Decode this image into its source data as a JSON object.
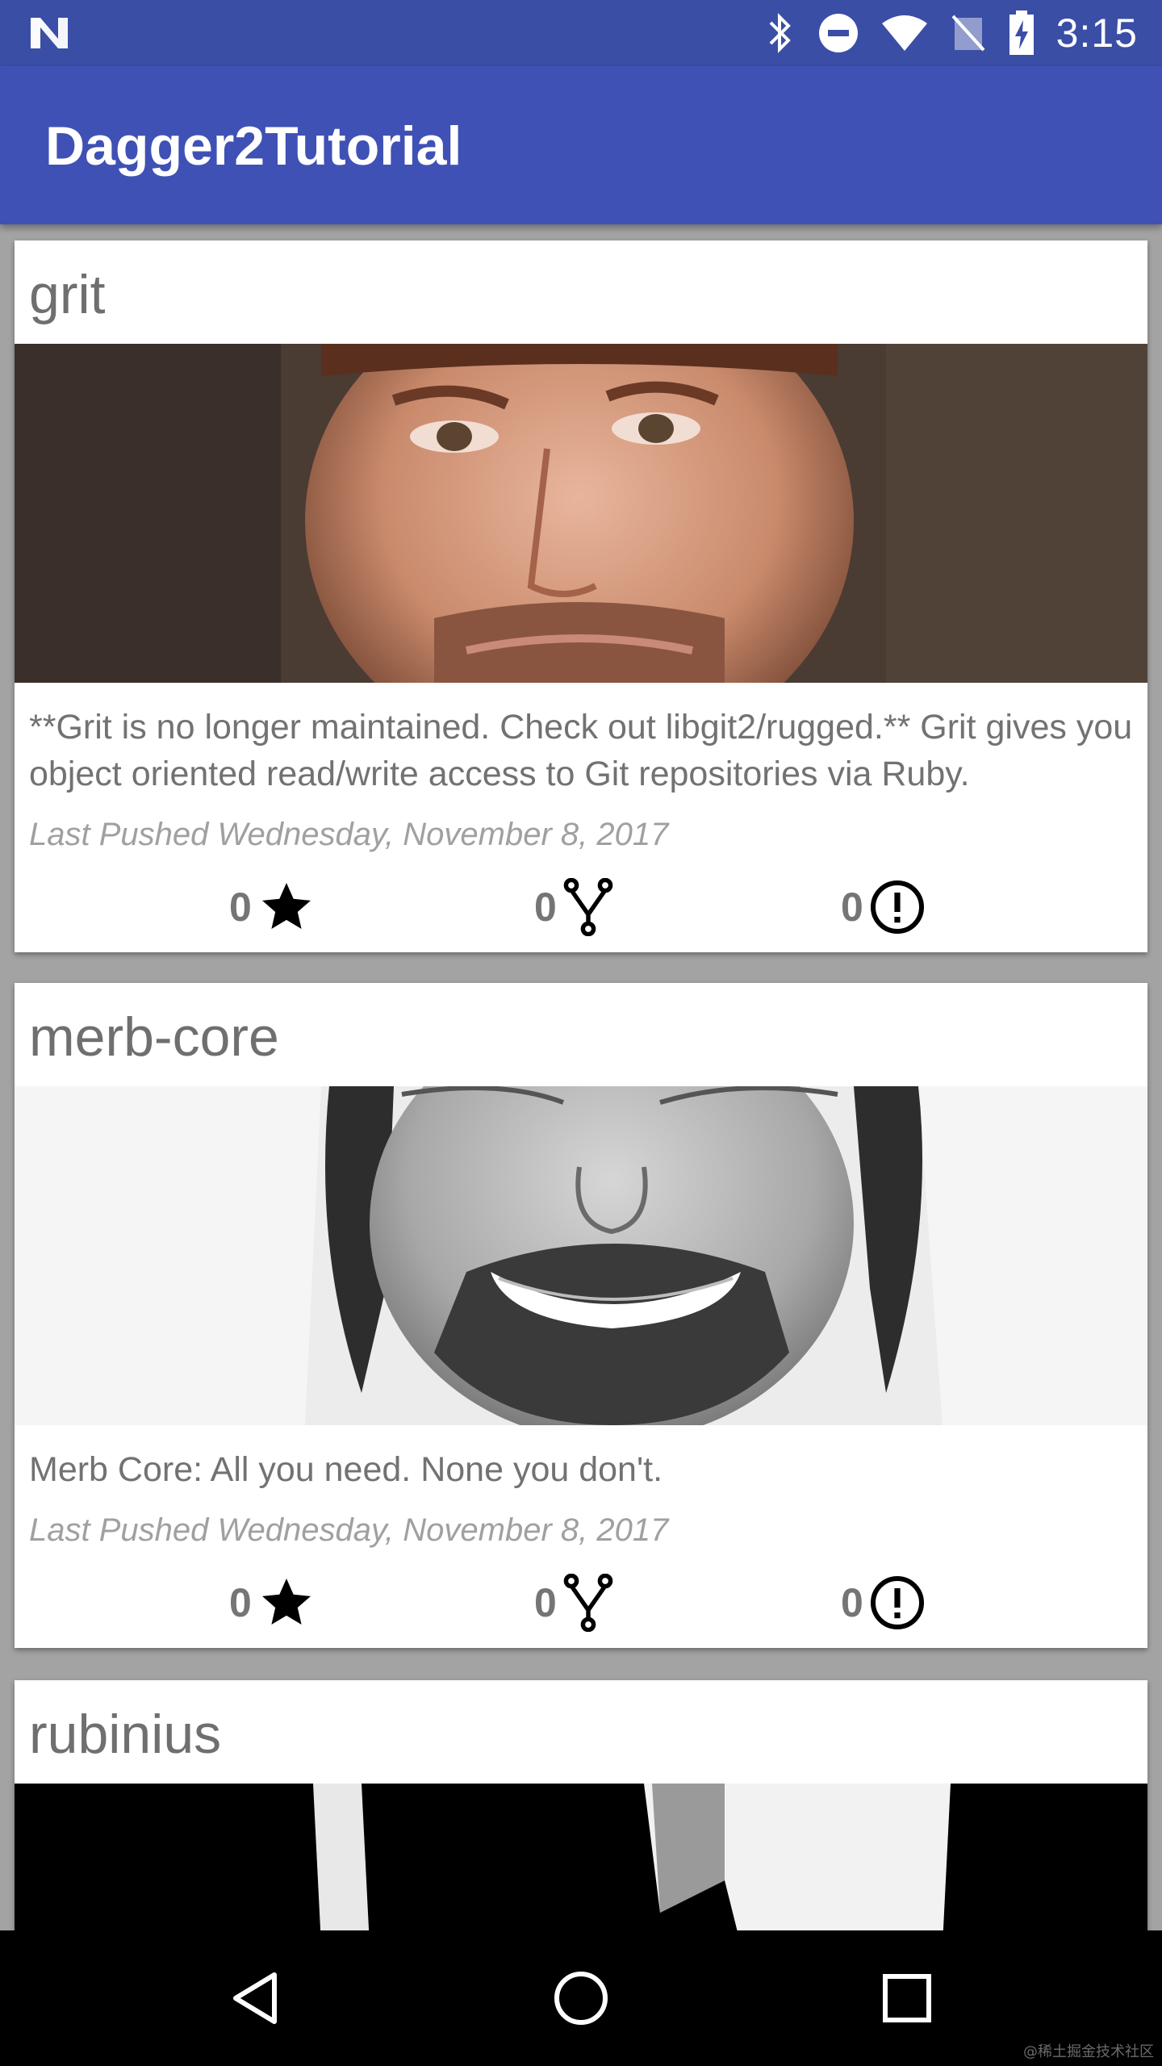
{
  "status_bar": {
    "time": "3:15",
    "icons": [
      "notification-n-icon",
      "bluetooth-icon",
      "do-not-disturb-icon",
      "wifi-icon",
      "no-sim-icon",
      "battery-charging-icon"
    ]
  },
  "app_bar": {
    "title": "Dagger2Tutorial",
    "color": "#3f51b5"
  },
  "repos": [
    {
      "name": "grit",
      "description": "**Grit is no longer maintained. Check out libgit2/rugged.** Grit gives you object oriented read/write access to Git repositories via Ruby.",
      "last_pushed": "Last Pushed Wednesday, November 8, 2017",
      "stars": "0",
      "forks": "0",
      "issues": "0",
      "avatar": "owner-avatar-photo"
    },
    {
      "name": "merb-core",
      "description": "Merb Core: All you need. None you don't.",
      "last_pushed": "Last Pushed Wednesday, November 8, 2017",
      "stars": "0",
      "forks": "0",
      "issues": "0",
      "avatar": "owner-avatar-photo"
    },
    {
      "name": "rubinius",
      "avatar": "owner-avatar-photo"
    }
  ],
  "nav_bar": {
    "icons": [
      "back-icon",
      "home-icon",
      "recents-icon"
    ]
  },
  "watermark": "@稀土掘金技术社区"
}
